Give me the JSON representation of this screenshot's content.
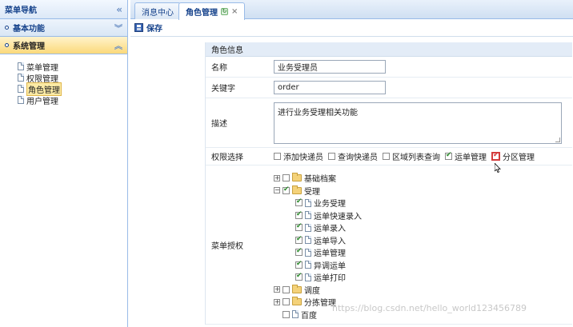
{
  "sidebar": {
    "title": "菜单导航",
    "collapse_icon": "«",
    "sections": [
      {
        "label": "基本功能",
        "icon": "double-chevron-down-icon",
        "glyph": "≚"
      },
      {
        "label": "系统管理",
        "icon": "double-chevron-up-icon",
        "glyph": "≙"
      }
    ],
    "tree": [
      {
        "label": "菜单管理"
      },
      {
        "label": "权限管理"
      },
      {
        "label": "角色管理",
        "selected": true
      },
      {
        "label": "用户管理"
      }
    ]
  },
  "tabs": [
    {
      "label": "消息中心"
    },
    {
      "label": "角色管理",
      "active": true,
      "close": "×"
    }
  ],
  "toolbar": {
    "save_label": "保存"
  },
  "form": {
    "section_title": "角色信息",
    "name_label": "名称",
    "name_value": "业务受理员",
    "keyword_label": "关键字",
    "keyword_value": "order",
    "desc_label": "描述",
    "desc_value": "进行业务受理相关功能",
    "perm_label": "权限选择",
    "permissions": [
      {
        "label": "添加快递员",
        "checked": false
      },
      {
        "label": "查询快递员",
        "checked": false
      },
      {
        "label": "区域列表查询",
        "checked": false
      },
      {
        "label": "运单管理",
        "checked": true
      },
      {
        "label": "分区管理",
        "checked": true
      }
    ],
    "menu_label": "菜单授权",
    "menu_tree": [
      {
        "label": "基础档案",
        "level": 0,
        "type": "folder",
        "expander": "+",
        "checked": false
      },
      {
        "label": "受理",
        "level": 0,
        "type": "folder",
        "expander": "−",
        "checked": true
      },
      {
        "label": "业务受理",
        "level": 1,
        "type": "file",
        "checked": true
      },
      {
        "label": "运单快速录入",
        "level": 1,
        "type": "file",
        "checked": true
      },
      {
        "label": "运单录入",
        "level": 1,
        "type": "file",
        "checked": true
      },
      {
        "label": "运单导入",
        "level": 1,
        "type": "file",
        "checked": true
      },
      {
        "label": "运单管理",
        "level": 1,
        "type": "file",
        "checked": true
      },
      {
        "label": "异调运单",
        "level": 1,
        "type": "file",
        "checked": true
      },
      {
        "label": "运单打印",
        "level": 1,
        "type": "file",
        "checked": true
      },
      {
        "label": "调度",
        "level": 0,
        "type": "folder",
        "expander": "+",
        "checked": false
      },
      {
        "label": "分拣管理",
        "level": 0,
        "type": "folder",
        "expander": "+",
        "checked": false
      },
      {
        "label": "百度",
        "level": 0,
        "type": "file",
        "checked": false
      }
    ]
  },
  "watermark": "https://blog.csdn.net/hello_world123456789"
}
